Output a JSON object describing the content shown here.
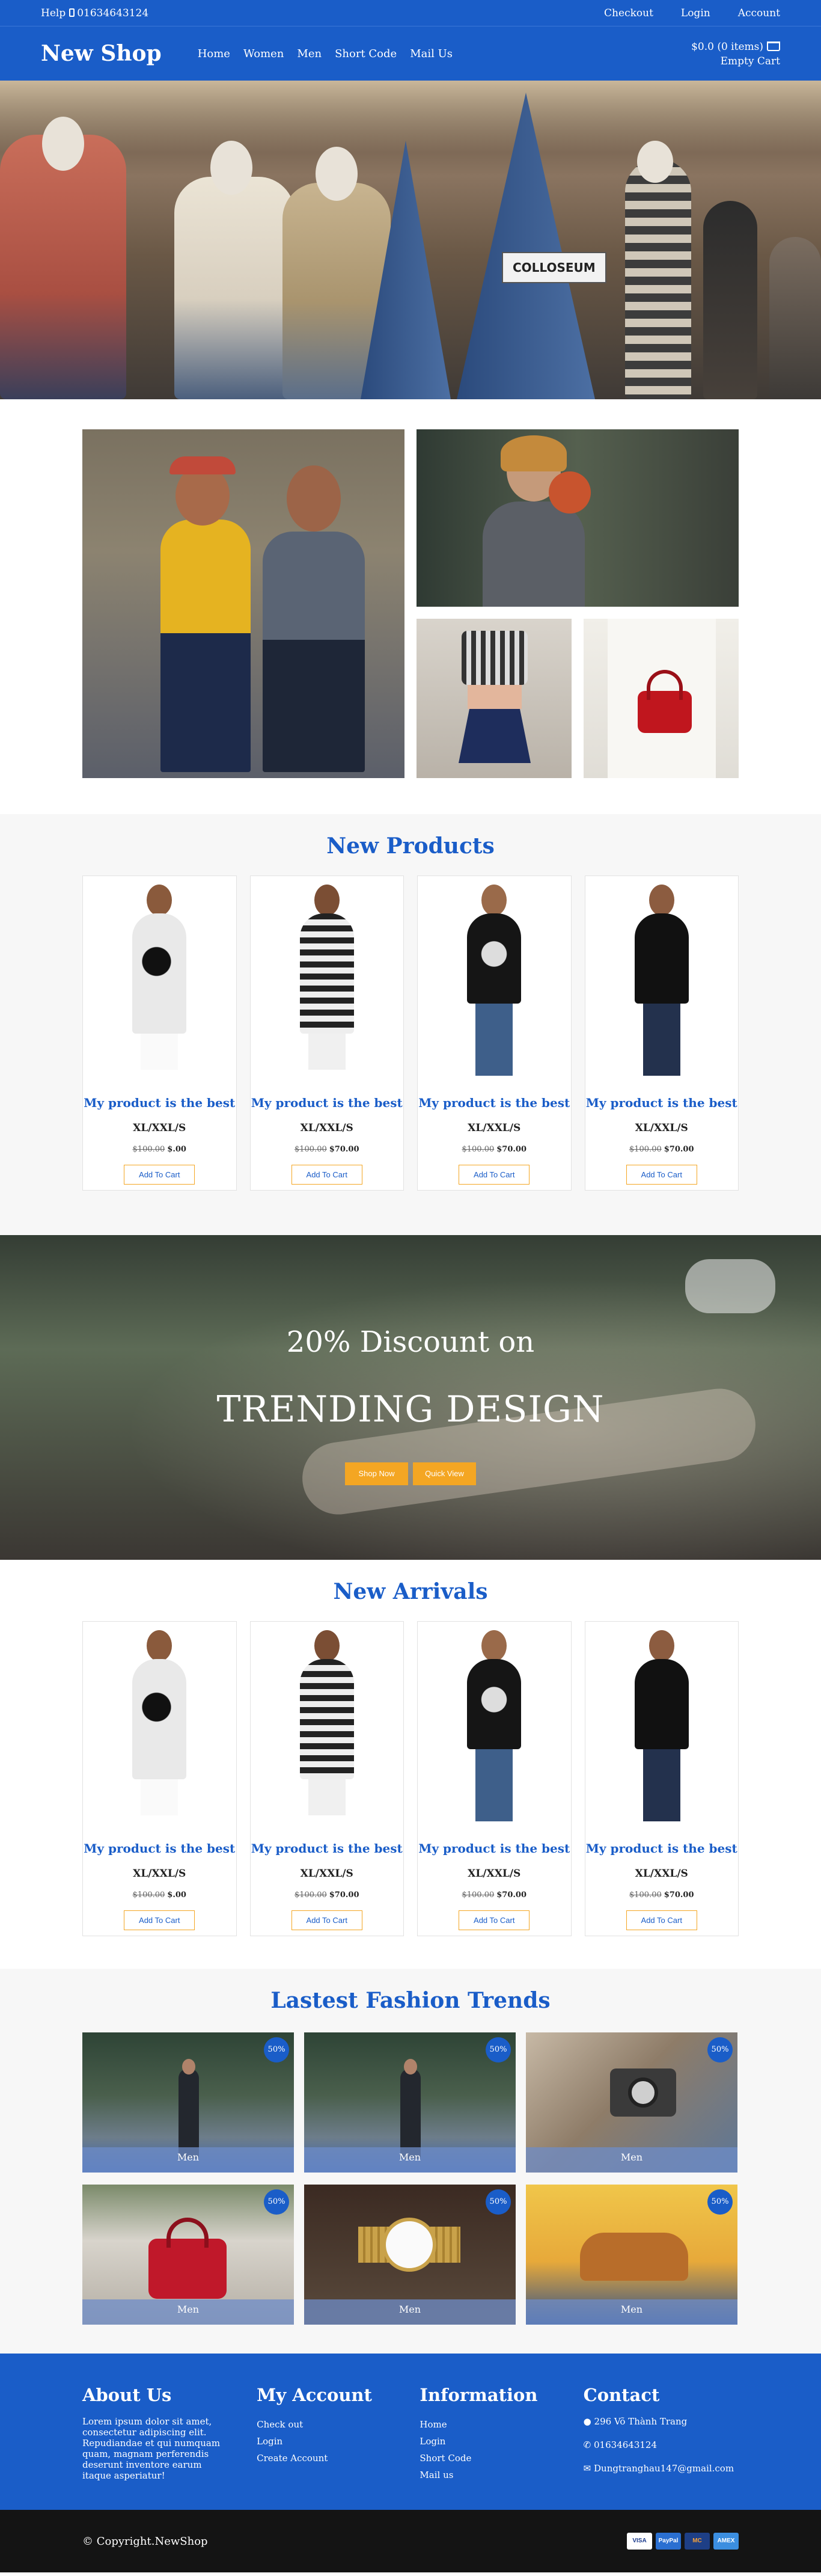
{
  "topbar": {
    "help": "Help",
    "phone": "01634643124",
    "links": [
      "Checkout",
      "Login",
      "Account"
    ]
  },
  "header": {
    "logo": "New Shop",
    "nav": [
      "Home",
      "Women",
      "Men",
      "Short Code",
      "Mail Us"
    ],
    "cart_total": "$0.0 (0 items)",
    "cart_empty": "Empty Cart"
  },
  "hero": {
    "sign_text": "COLLOSEUM"
  },
  "new_products": {
    "title": "New Products",
    "items": [
      {
        "name": "My product is the best",
        "size": "XL/XXL/S",
        "old_price": "$100.00",
        "price": "$.00",
        "button": "Add To Cart"
      },
      {
        "name": "My product is the best",
        "size": "XL/XXL/S",
        "old_price": "$100.00",
        "price": "$70.00",
        "button": "Add To Cart"
      },
      {
        "name": "My product is the best",
        "size": "XL/XXL/S",
        "old_price": "$100.00",
        "price": "$70.00",
        "button": "Add To Cart"
      },
      {
        "name": "My product is the best",
        "size": "XL/XXL/S",
        "old_price": "$100.00",
        "price": "$70.00",
        "button": "Add To Cart"
      }
    ]
  },
  "banner": {
    "line1": "20% Discount on",
    "line2": "TRENDING DESIGN",
    "buttons": [
      "Shop Now",
      "Quick View"
    ]
  },
  "new_arrivals": {
    "title": "New Arrivals",
    "items": [
      {
        "name": "My product is the best",
        "size": "XL/XXL/S",
        "old_price": "$100.00",
        "price": "$.00",
        "button": "Add To Cart"
      },
      {
        "name": "My product is the best",
        "size": "XL/XXL/S",
        "old_price": "$100.00",
        "price": "$70.00",
        "button": "Add To Cart"
      },
      {
        "name": "My product is the best",
        "size": "XL/XXL/S",
        "old_price": "$100.00",
        "price": "$70.00",
        "button": "Add To Cart"
      },
      {
        "name": "My product is the best",
        "size": "XL/XXL/S",
        "old_price": "$100.00",
        "price": "$70.00",
        "button": "Add To Cart"
      }
    ]
  },
  "trends": {
    "title": "Lastest Fashion Trends",
    "tiles": [
      {
        "caption": "Men",
        "badge": "50%"
      },
      {
        "caption": "Men",
        "badge": "50%"
      },
      {
        "caption": "Men",
        "badge": "50%"
      },
      {
        "caption": "Men",
        "badge": "50%"
      },
      {
        "caption": "Men",
        "badge": "50%"
      },
      {
        "caption": "Men",
        "badge": "50%"
      }
    ]
  },
  "footer": {
    "about": {
      "title": "About Us",
      "text": "Lorem ipsum dolor sit amet, consectetur adipiscing elit. Repudiandae et qui numquam quam, magnam perferendis deserunt inventore earum itaque asperiatur!"
    },
    "account": {
      "title": "My Account",
      "links": [
        "Check out",
        "Login",
        "Create Account"
      ]
    },
    "info": {
      "title": "Information",
      "links": [
        "Home",
        "Login",
        "Short Code",
        "Mail us"
      ]
    },
    "contact": {
      "title": "Contact",
      "address": "296 Võ Thành Trang",
      "phone": "01634643124",
      "email": "Dungtranghau147@gmail.com"
    }
  },
  "bottom": {
    "copyright": "© Copyright.NewShop",
    "cards": [
      "VISA",
      "PayPal",
      "MC",
      "AMEX"
    ]
  }
}
